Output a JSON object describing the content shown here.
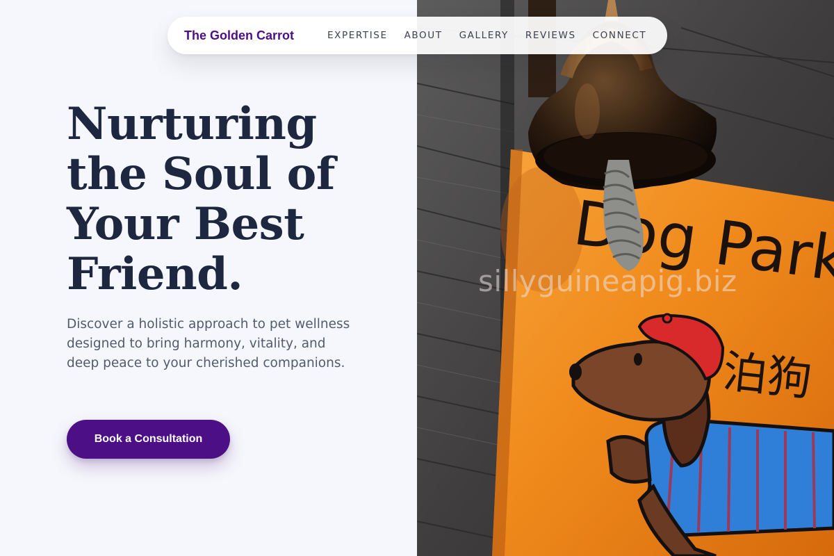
{
  "brand": {
    "name": "The Golden Carrot",
    "color": "#4d0f86"
  },
  "nav": {
    "links": [
      "EXPERTISE",
      "ABOUT",
      "GALLERY",
      "REVIEWS",
      "CONNECT"
    ]
  },
  "hero": {
    "title_lines": [
      "Nurturing",
      "the Soul of",
      "Your Best",
      "Friend."
    ],
    "description": "Discover a holistic approach to pet wellness designed to bring harmony, vitality, and deep peace to your cherished companions.",
    "cta_label": "Book a Consultation"
  },
  "photo": {
    "sign_text": "Dog Parkin",
    "sign_chinese": "泊狗",
    "watermark": "sillyguineapig.biz"
  },
  "colors": {
    "background": "#f6f7fc",
    "heading": "#1d2840",
    "body_text": "#525b6b",
    "accent": "#4d0f86",
    "sign_orange": "#f08a1c"
  }
}
